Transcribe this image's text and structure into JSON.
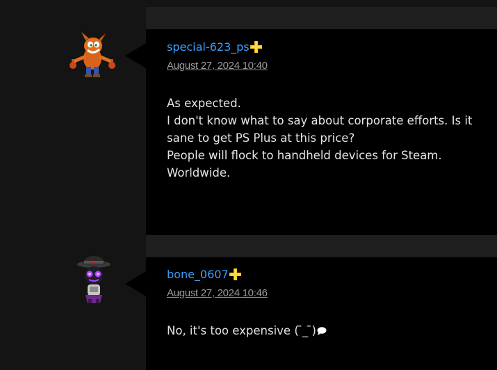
{
  "comments": [
    {
      "username": "special-623_ps",
      "plus_badge": "ps-plus-icon",
      "timestamp": "August 27, 2024 10:40",
      "avatar": "crash-bandicoot-avatar",
      "lines": [
        "As expected.",
        "I don't know what to say about corporate efforts. Is it sane to get PS Plus at this price?",
        "People will flock to handheld devices for Steam. Worldwide."
      ]
    },
    {
      "username": "bone_0607",
      "plus_badge": "ps-plus-icon",
      "timestamp": "August 27, 2024 10:46",
      "avatar": "sackboy-hat-avatar",
      "lines": [
        "No, it's too expensive ( ̄_ ̄)"
      ],
      "trailing_icon": "speech-bubble-icon"
    }
  ],
  "colors": {
    "username": "#3aa0ff",
    "plus_badge": "#f5c518",
    "comment_bg": "#000000",
    "page_bg": "#141414"
  }
}
